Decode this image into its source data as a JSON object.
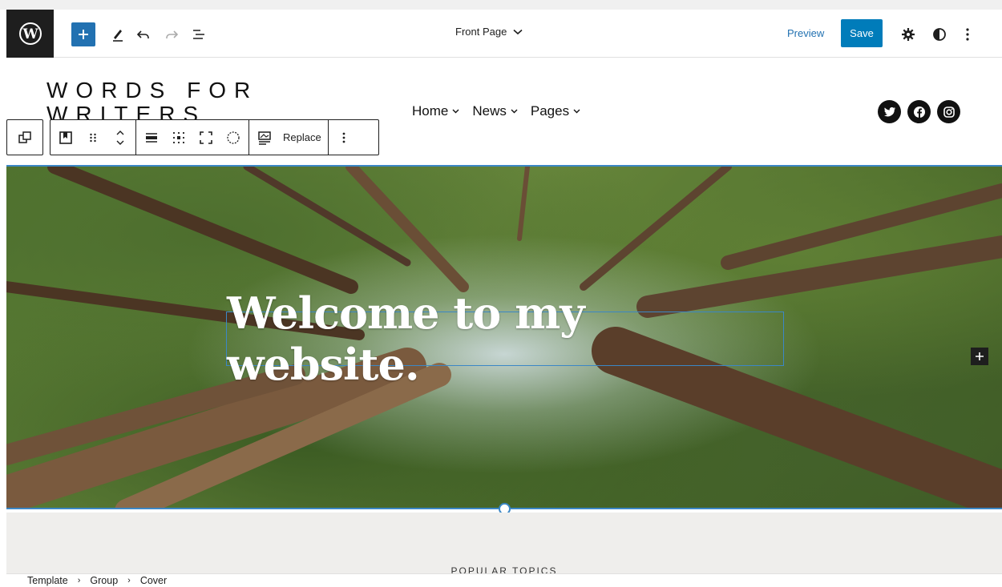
{
  "header": {
    "document_title": "Front Page",
    "preview_label": "Preview",
    "save_label": "Save"
  },
  "site": {
    "title": "WORDS FOR WRITERS",
    "nav": [
      {
        "label": "Home"
      },
      {
        "label": "News"
      },
      {
        "label": "Pages"
      }
    ],
    "social": [
      "twitter-icon",
      "facebook-icon",
      "instagram-icon"
    ]
  },
  "block_toolbar": {
    "replace_label": "Replace"
  },
  "cover": {
    "heading": "Welcome to my website."
  },
  "below": {
    "section_label": "POPULAR TOPICS"
  },
  "breadcrumb": [
    "Template",
    "Group",
    "Cover"
  ],
  "colors": {
    "accent": "#007cba",
    "dark": "#1e1e1e",
    "selection": "#3b87c6"
  }
}
